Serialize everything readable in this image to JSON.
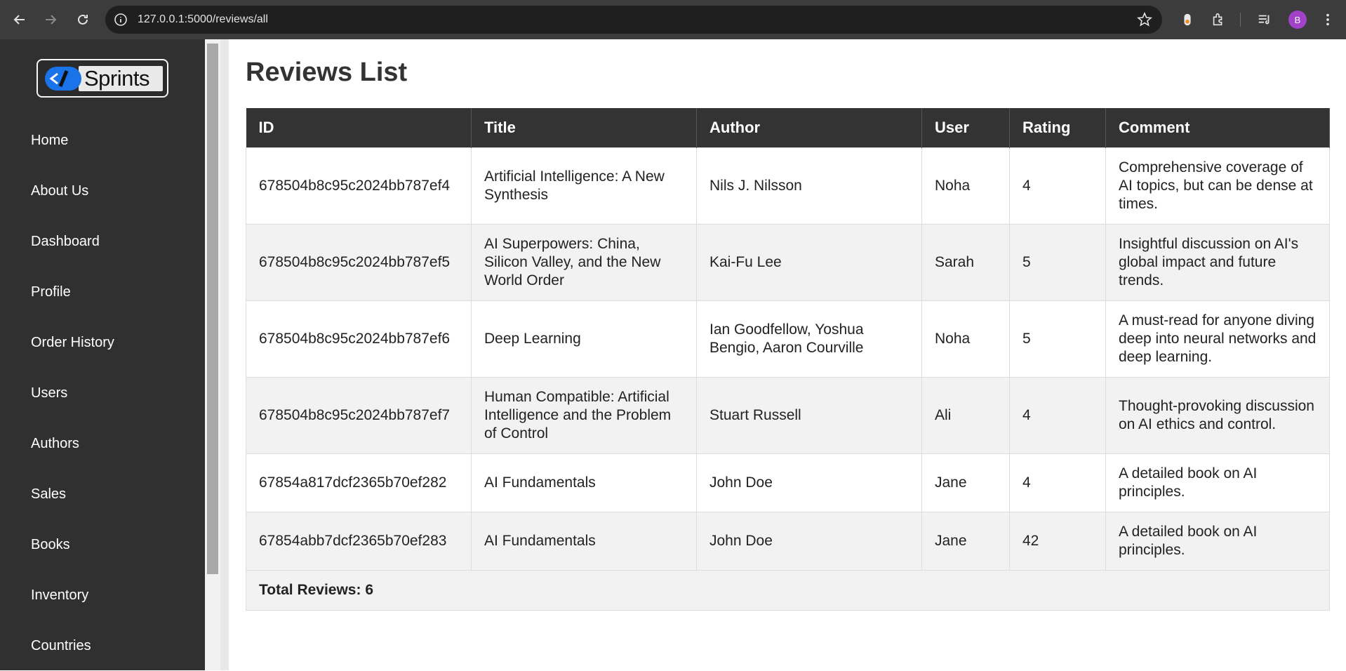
{
  "browser": {
    "url": "127.0.0.1:5000/reviews/all",
    "profile_initial": "B"
  },
  "sidebar": {
    "logo_text": "Sprints",
    "items": [
      {
        "label": "Home"
      },
      {
        "label": "About Us"
      },
      {
        "label": "Dashboard"
      },
      {
        "label": "Profile"
      },
      {
        "label": "Order History"
      },
      {
        "label": "Users"
      },
      {
        "label": "Authors"
      },
      {
        "label": "Sales"
      },
      {
        "label": "Books"
      },
      {
        "label": "Inventory"
      },
      {
        "label": "Countries"
      }
    ]
  },
  "main": {
    "title": "Reviews List",
    "columns": [
      "ID",
      "Title",
      "Author",
      "User",
      "Rating",
      "Comment"
    ],
    "rows": [
      {
        "id": "678504b8c95c2024bb787ef4",
        "title": "Artificial Intelligence: A New Synthesis",
        "author": "Nils J. Nilsson",
        "user": "Noha",
        "rating": "4",
        "comment": "Comprehensive coverage of AI topics, but can be dense at times."
      },
      {
        "id": "678504b8c95c2024bb787ef5",
        "title": "AI Superpowers: China, Silicon Valley, and the New World Order",
        "author": "Kai-Fu Lee",
        "user": "Sarah",
        "rating": "5",
        "comment": "Insightful discussion on AI's global impact and future trends."
      },
      {
        "id": "678504b8c95c2024bb787ef6",
        "title": "Deep Learning",
        "author": "Ian Goodfellow, Yoshua Bengio, Aaron Courville",
        "user": "Noha",
        "rating": "5",
        "comment": "A must-read for anyone diving deep into neural networks and deep learning."
      },
      {
        "id": "678504b8c95c2024bb787ef7",
        "title": "Human Compatible: Artificial Intelligence and the Problem of Control",
        "author": "Stuart Russell",
        "user": "Ali",
        "rating": "4",
        "comment": "Thought-provoking discussion on AI ethics and control."
      },
      {
        "id": "67854a817dcf2365b70ef282",
        "title": "AI Fundamentals",
        "author": "John Doe",
        "user": "Jane",
        "rating": "4",
        "comment": "A detailed book on AI principles."
      },
      {
        "id": "67854abb7dcf2365b70ef283",
        "title": "AI Fundamentals",
        "author": "John Doe",
        "user": "Jane",
        "rating": "42",
        "comment": "A detailed book on AI principles."
      }
    ],
    "total_label": "Total Reviews: 6"
  },
  "colors": {
    "sidebar_bg": "#303030",
    "table_header_bg": "#333333",
    "logo_blue": "#1a73e8"
  }
}
